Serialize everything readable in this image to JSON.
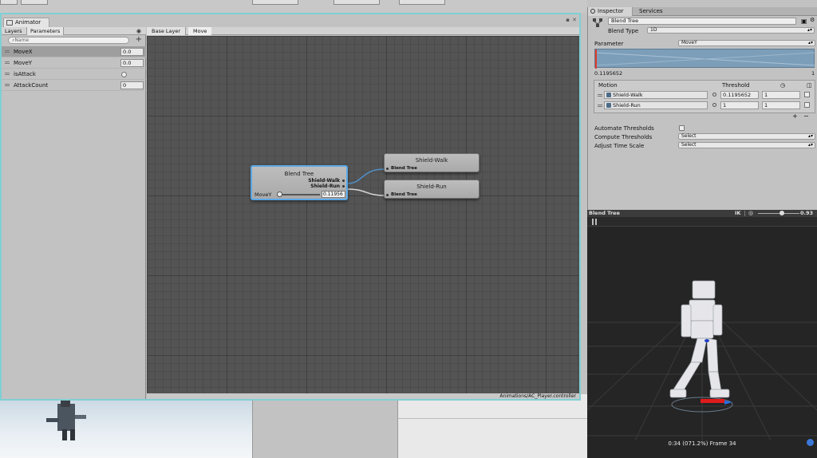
{
  "animator": {
    "tab_title": "Animator",
    "left_tabs": [
      "Layers",
      "Parameters"
    ],
    "search_placeholder": "Name",
    "parameters": [
      {
        "name": "MoveX",
        "value": "0.0"
      },
      {
        "name": "MoveY",
        "value": "0.0"
      },
      {
        "name": "isAttack",
        "value": ""
      },
      {
        "name": "AttackCount",
        "value": "0"
      }
    ],
    "breadcrumb": [
      "Base Layer",
      "Move"
    ],
    "footer_path": "Animations/AC_Player.controller",
    "blend_node": {
      "title": "Blend Tree",
      "outputs": [
        "Shield-Walk",
        "Shield-Run"
      ],
      "param_name": "MoveY",
      "param_value": "0.11956"
    },
    "motion_nodes": [
      {
        "title": "Shield-Walk",
        "sub": "Blend Tree"
      },
      {
        "title": "Shield-Run",
        "sub": "Blend Tree"
      }
    ]
  },
  "inspector": {
    "tabs": [
      "Inspector",
      "Services"
    ],
    "object_name": "Blend Tree",
    "blend_type_label": "Blend Type",
    "blend_type_value": "1D",
    "parameter_label": "Parameter",
    "parameter_value": "MoveY",
    "graph_value": "0.1195652",
    "graph_max": "1",
    "motion_header": "Motion",
    "threshold_header": "Threshold",
    "motions": [
      {
        "name": "Shield-Walk",
        "threshold": "0.1195652",
        "speed": "1"
      },
      {
        "name": "Shield-Run",
        "threshold": "1",
        "speed": "1"
      }
    ],
    "list_add": "+",
    "list_remove": "−",
    "automate_label": "Automate Thresholds",
    "compute_label": "Compute Thresholds",
    "compute_value": "Select",
    "adjust_label": "Adjust Time Scale",
    "adjust_value": "Select"
  },
  "preview": {
    "title": "Blend Tree",
    "ik_label": "IK",
    "speed_value": "0.93",
    "status": "0:34 (071.2%) Frame 34"
  },
  "colors": {
    "window_border": "#7fd0d4",
    "selected_node_border": "#5aa8e6",
    "graph_bg": "#545454",
    "blend_graph_bg": "#7d9eb9"
  }
}
